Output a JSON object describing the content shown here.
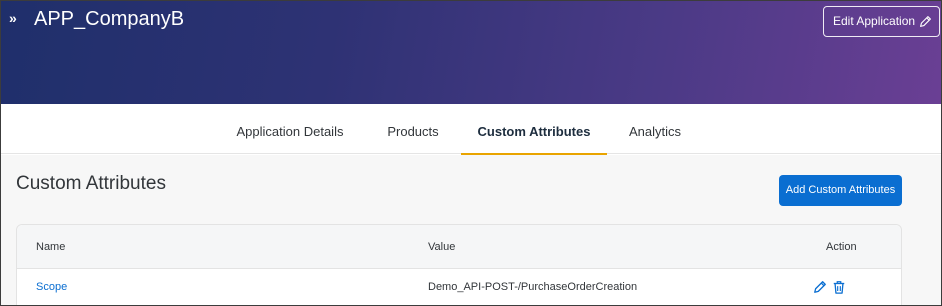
{
  "header": {
    "app_title": "APP_CompanyB",
    "nav_toggle_glyph": "»",
    "edit_button_label": "Edit Application",
    "edit_icon": "pencil-icon"
  },
  "tabs": [
    {
      "label": "Application Details",
      "active": false
    },
    {
      "label": "Products",
      "active": false
    },
    {
      "label": "Custom Attributes",
      "active": true
    },
    {
      "label": "Analytics",
      "active": false
    }
  ],
  "section": {
    "title": "Custom Attributes",
    "add_button_label": "Add Custom Attributes"
  },
  "table": {
    "columns": [
      "Name",
      "Value",
      "Action"
    ],
    "rows": [
      {
        "name": "Scope",
        "value": "Demo_API-POST-/PurchaseOrderCreation",
        "actions": [
          "edit-icon",
          "delete-icon"
        ]
      }
    ]
  },
  "colors": {
    "accent": "#0a6ed1",
    "active_tab_indicator": "#e9a400",
    "header_gradient_start": "#1f2f6b",
    "header_gradient_end": "#6a3f94"
  }
}
